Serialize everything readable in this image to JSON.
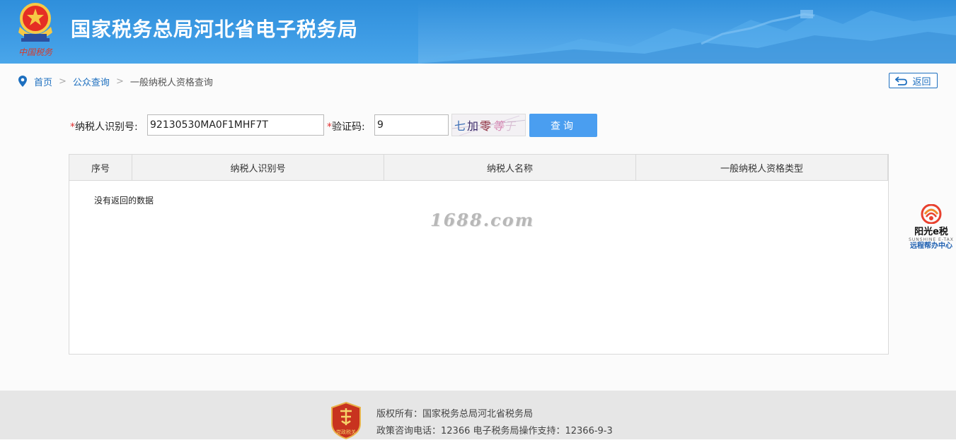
{
  "header": {
    "title": "国家税务总局河北省电子税务局",
    "logo_caption": "中国税务"
  },
  "breadcrumb": {
    "home": "首页",
    "public_query": "公众查询",
    "current": "一般纳税人资格查询"
  },
  "back_button": {
    "label": "返回"
  },
  "form": {
    "taxpayer_id": {
      "required_mark": "*",
      "label": "纳税人识别号:",
      "value": "92130530MA0F1MHF7T"
    },
    "captcha": {
      "required_mark": "*",
      "label": "验证码:",
      "value": "9",
      "image_text": "七加零等于"
    },
    "query_button": "查询"
  },
  "table": {
    "columns": [
      "序号",
      "纳税人识别号",
      "纳税人名称",
      "一般纳税人资格类型"
    ],
    "rows": [],
    "empty_message": "没有返回的数据"
  },
  "watermark": "1688.com",
  "side_widget": {
    "title": "阳光e税",
    "subtitle": "SUNSHINE E-TAX",
    "caption": "远程帮办中心"
  },
  "footer": {
    "badge_text": "党政税关",
    "copyright": "版权所有：国家税务总局河北省税务局",
    "contact": "政策咨询电话：12366  电子税务局操作支持：12366-9-3"
  },
  "colors": {
    "header_blue": "#3d9be4",
    "link_blue": "#1d6fbf",
    "button_blue": "#4a9ef0",
    "required_red": "#e03030"
  }
}
